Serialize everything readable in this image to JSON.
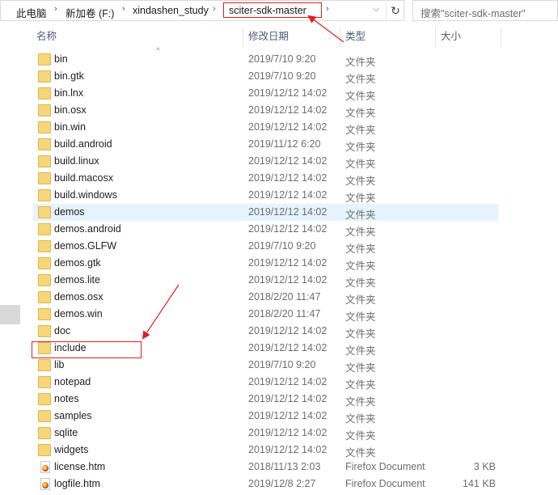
{
  "address_bar": {
    "crumbs": [
      "此电脑",
      "新加卷 (F:)",
      "xindashen_study",
      "sciter-sdk-master"
    ]
  },
  "search": {
    "placeholder": "搜索\"sciter-sdk-master\""
  },
  "columns": {
    "name": "名称",
    "date": "修改日期",
    "type": "类型",
    "size": "大小"
  },
  "files": [
    {
      "name": "bin",
      "date": "2019/7/10 9:20",
      "type": "文件夹",
      "size": "",
      "kind": "folder"
    },
    {
      "name": "bin.gtk",
      "date": "2019/7/10 9:20",
      "type": "文件夹",
      "size": "",
      "kind": "folder"
    },
    {
      "name": "bin.lnx",
      "date": "2019/12/12 14:02",
      "type": "文件夹",
      "size": "",
      "kind": "folder"
    },
    {
      "name": "bin.osx",
      "date": "2019/12/12 14:02",
      "type": "文件夹",
      "size": "",
      "kind": "folder"
    },
    {
      "name": "bin.win",
      "date": "2019/12/12 14:02",
      "type": "文件夹",
      "size": "",
      "kind": "folder"
    },
    {
      "name": "build.android",
      "date": "2019/11/12 6:20",
      "type": "文件夹",
      "size": "",
      "kind": "folder"
    },
    {
      "name": "build.linux",
      "date": "2019/12/12 14:02",
      "type": "文件夹",
      "size": "",
      "kind": "folder"
    },
    {
      "name": "build.macosx",
      "date": "2019/12/12 14:02",
      "type": "文件夹",
      "size": "",
      "kind": "folder"
    },
    {
      "name": "build.windows",
      "date": "2019/12/12 14:02",
      "type": "文件夹",
      "size": "",
      "kind": "folder"
    },
    {
      "name": "demos",
      "date": "2019/12/12 14:02",
      "type": "文件夹",
      "size": "",
      "kind": "folder"
    },
    {
      "name": "demos.android",
      "date": "2019/12/12 14:02",
      "type": "文件夹",
      "size": "",
      "kind": "folder"
    },
    {
      "name": "demos.GLFW",
      "date": "2019/7/10 9:20",
      "type": "文件夹",
      "size": "",
      "kind": "folder"
    },
    {
      "name": "demos.gtk",
      "date": "2019/12/12 14:02",
      "type": "文件夹",
      "size": "",
      "kind": "folder"
    },
    {
      "name": "demos.lite",
      "date": "2019/12/12 14:02",
      "type": "文件夹",
      "size": "",
      "kind": "folder"
    },
    {
      "name": "demos.osx",
      "date": "2018/2/20 11:47",
      "type": "文件夹",
      "size": "",
      "kind": "folder"
    },
    {
      "name": "demos.win",
      "date": "2018/2/20 11:47",
      "type": "文件夹",
      "size": "",
      "kind": "folder"
    },
    {
      "name": "doc",
      "date": "2019/12/12 14:02",
      "type": "文件夹",
      "size": "",
      "kind": "folder"
    },
    {
      "name": "include",
      "date": "2019/12/12 14:02",
      "type": "文件夹",
      "size": "",
      "kind": "folder"
    },
    {
      "name": "lib",
      "date": "2019/7/10 9:20",
      "type": "文件夹",
      "size": "",
      "kind": "folder"
    },
    {
      "name": "notepad",
      "date": "2019/12/12 14:02",
      "type": "文件夹",
      "size": "",
      "kind": "folder"
    },
    {
      "name": "notes",
      "date": "2019/12/12 14:02",
      "type": "文件夹",
      "size": "",
      "kind": "folder"
    },
    {
      "name": "samples",
      "date": "2019/12/12 14:02",
      "type": "文件夹",
      "size": "",
      "kind": "folder"
    },
    {
      "name": "sqlite",
      "date": "2019/12/12 14:02",
      "type": "文件夹",
      "size": "",
      "kind": "folder"
    },
    {
      "name": "widgets",
      "date": "2019/12/12 14:02",
      "type": "文件夹",
      "size": "",
      "kind": "folder"
    },
    {
      "name": "license.htm",
      "date": "2018/11/13 2:03",
      "type": "Firefox Document",
      "size": "3 KB",
      "kind": "firefox-document"
    },
    {
      "name": "logfile.htm",
      "date": "2019/12/8 2:27",
      "type": "Firefox Document",
      "size": "141 KB",
      "kind": "firefox-document"
    }
  ],
  "hovered_row": "demos",
  "annotation_color": "#e02020"
}
